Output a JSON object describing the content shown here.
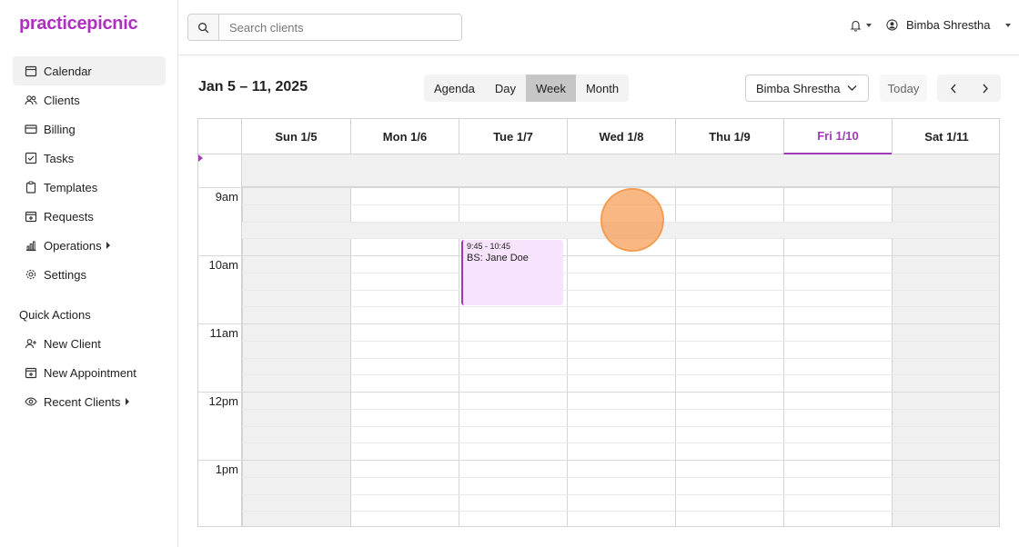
{
  "app": {
    "logo": "practicepicnic"
  },
  "sidebar": {
    "items": [
      {
        "label": "Calendar",
        "icon": "calendar-icon",
        "active": true
      },
      {
        "label": "Clients",
        "icon": "users-icon"
      },
      {
        "label": "Billing",
        "icon": "credit-card-icon"
      },
      {
        "label": "Tasks",
        "icon": "checkbox-icon"
      },
      {
        "label": "Templates",
        "icon": "clipboard-icon"
      },
      {
        "label": "Requests",
        "icon": "calendar-plus-icon"
      },
      {
        "label": "Operations",
        "icon": "bar-chart-icon",
        "has_submenu": true
      },
      {
        "label": "Settings",
        "icon": "gear-icon"
      }
    ],
    "quick_actions_title": "Quick Actions",
    "quick_actions": [
      {
        "label": "New Client",
        "icon": "user-plus-icon"
      },
      {
        "label": "New Appointment",
        "icon": "calendar-plus-icon"
      },
      {
        "label": "Recent Clients",
        "icon": "eye-icon",
        "has_submenu": true
      }
    ]
  },
  "topbar": {
    "search_placeholder": "Search clients",
    "user_name": "Bimba Shrestha"
  },
  "toolbar": {
    "range_title": "Jan 5 – 11, 2025",
    "views": [
      "Agenda",
      "Day",
      "Week",
      "Month"
    ],
    "active_view": "Week",
    "provider": "Bimba Shrestha",
    "today_label": "Today"
  },
  "calendar": {
    "days": [
      "Sun 1/5",
      "Mon 1/6",
      "Tue 1/7",
      "Wed 1/8",
      "Thu 1/9",
      "Fri 1/10",
      "Sat 1/11"
    ],
    "today": "Fri 1/10",
    "hours": [
      "9am",
      "10am",
      "11am",
      "12pm",
      "1pm"
    ],
    "events": [
      {
        "day": "Tue 1/7",
        "time": "9:45 - 10:45",
        "title": "BS: Jane Doe"
      }
    ]
  },
  "colors": {
    "brand": "#b02fc2",
    "today_accent": "#a33ab8",
    "event_bg": "#f7e3fb",
    "weekend_bg": "#f0f0f0"
  }
}
